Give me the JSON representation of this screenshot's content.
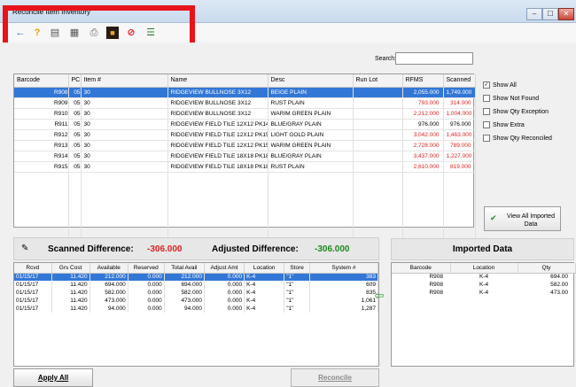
{
  "window": {
    "title": "Reconcile Item Inventory"
  },
  "window_controls": {
    "minimize": "–",
    "maximize": "☐",
    "close": "✕"
  },
  "toolbar": {
    "icons": [
      "back-arrow-icon",
      "help-icon",
      "edit-documents-icon",
      "document-icon",
      "print-icon",
      "stop-icon",
      "cancel-icon",
      "export-icon"
    ]
  },
  "search": {
    "label": "Search:",
    "value": ""
  },
  "grid": {
    "columns": [
      "Barcode",
      "PC",
      "Item #",
      "Name",
      "Desc",
      "Run Lot",
      "RFMS",
      "Scanned"
    ],
    "rows": [
      [
        "R908",
        "05",
        "30",
        "RIDGEVIEW BULLNOSE 3X12",
        "BEIGE PLAIN",
        "",
        "2,055.000",
        "1,749.000"
      ],
      [
        "R909",
        "05",
        "30",
        "RIDGEVIEW BULLNOSE 3X12",
        "RUST PLAIN",
        "",
        "793.000",
        "314.000"
      ],
      [
        "R910",
        "05",
        "30",
        "RIDGEVIEW BULLNOSE 3X12",
        "WARIM GREEN PLAIN",
        "",
        "2,212.000",
        "1,004.000"
      ],
      [
        "R911",
        "05",
        "30",
        "RIDGEVIEW FIELD TILE 12X12 PK14.",
        "BLUE/GRAY PLAIN",
        "",
        "976.000",
        "976.000"
      ],
      [
        "R912",
        "05",
        "30",
        "RIDGEVIEW FIELD TILE 12X12 PK15.",
        "LIGHT GOLD PLAIN",
        "",
        "3,042.000",
        "1,463.000"
      ],
      [
        "R913",
        "05",
        "30",
        "RIDGEVIEW FIELD TILE 12X12 PK15.",
        "WARIM GREEN PLAIN",
        "",
        "2,728.000",
        "789.000"
      ],
      [
        "R914",
        "05",
        "30",
        "RIDGEVIEW FIELD TILE 18X18 PK18.",
        "BLUE/GRAY PLAIN",
        "",
        "3,437.000",
        "1,227.000"
      ],
      [
        "R915",
        "05",
        "30",
        "RIDGEVIEW FIELD TILE 18X18 PK18.",
        "RUST PLAIN",
        "",
        "2,610.000",
        "819.000"
      ]
    ]
  },
  "filters": {
    "show_all": "Show All",
    "show_not_found": "Show Not Found",
    "show_qty_exception": "Show Qty Exception",
    "show_extra": "Show Extra",
    "show_qty_reconciled": "Show Qty Reconciled"
  },
  "view_all_button": "View All Imported Data",
  "difference": {
    "scanned_label": "Scanned Difference:",
    "scanned_value": "-306.000",
    "adjusted_label": "Adjusted Difference:",
    "adjusted_value": "-306.000"
  },
  "lower_grid": {
    "columns": [
      "Rcvd",
      "Grs Cost",
      "Available",
      "Reserved",
      "Total Avail",
      "Adjust Amt",
      "Location",
      "Store",
      "System #"
    ],
    "rows": [
      [
        "01/15/17",
        "11.420",
        "212.000",
        "0.000",
        "212.000",
        "0.000",
        "K-4",
        "\"1\"",
        "383"
      ],
      [
        "01/15/17",
        "11.420",
        "694.000",
        "0.000",
        "694.000",
        "0.000",
        "K-4",
        "\"1\"",
        "609"
      ],
      [
        "01/15/17",
        "11.420",
        "582.000",
        "0.000",
        "582.000",
        "0.000",
        "K-4",
        "\"1\"",
        "835"
      ],
      [
        "01/15/17",
        "11.420",
        "473.000",
        "0.000",
        "473.000",
        "0.000",
        "K-4",
        "\"1\"",
        "1,061"
      ],
      [
        "01/15/17",
        "11.420",
        "94.000",
        "0.000",
        "94.000",
        "0.000",
        "K-4",
        "\"1\"",
        "1,287"
      ]
    ]
  },
  "imported": {
    "title": "Imported Data",
    "columns": [
      "Barcode",
      "Location",
      "Qty"
    ],
    "rows": [
      [
        "R908",
        "K-4",
        "694.00"
      ],
      [
        "R908",
        "K-4",
        "582.00"
      ],
      [
        "R908",
        "K-4",
        "473.00"
      ]
    ]
  },
  "buttons": {
    "apply_all": "Apply All",
    "reconcile": "Reconcile"
  },
  "colors": {
    "selection": "#3377d6",
    "negative": "#e02020",
    "positive": "#1e8a1e",
    "highlight": "#e8131b"
  }
}
